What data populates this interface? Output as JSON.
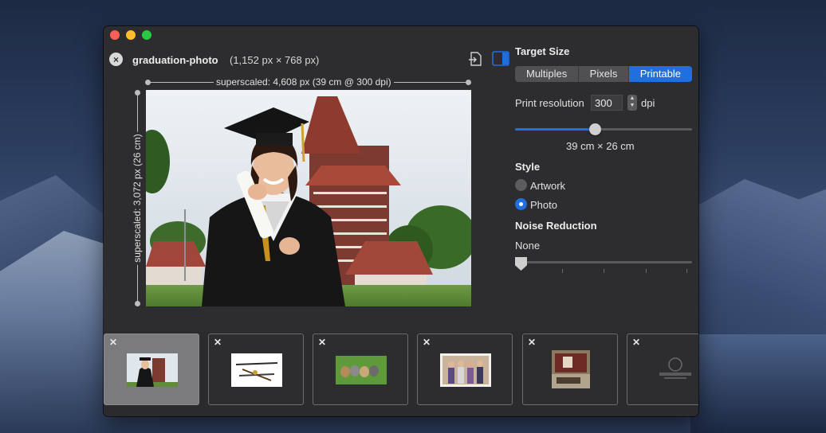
{
  "window": {
    "file_name": "graduation-photo",
    "file_size": "(1,152 px × 768 px)"
  },
  "preview": {
    "width_label": "superscaled: 4,608 px (39 cm @ 300 dpi)",
    "height_label": "superscaled: 3,072 px (26 cm)"
  },
  "sidebar": {
    "target_size_title": "Target Size",
    "modes": [
      "Multiples",
      "Pixels",
      "Printable"
    ],
    "active_mode": "Printable",
    "print_resolution_label": "Print resolution",
    "print_resolution_value": "300",
    "dpi_label": "dpi",
    "resolution_slider_fraction": 0.45,
    "print_size": "39 cm × 26 cm",
    "style_title": "Style",
    "style_options": [
      "Artwork",
      "Photo"
    ],
    "style_selected": "Photo",
    "noise_title": "Noise Reduction",
    "noise_value": "None",
    "noise_slider_fraction": 0.0
  },
  "thumbnails": [
    {
      "content": "graduation photo",
      "selected": true
    },
    {
      "content": "tools diagram",
      "selected": false
    },
    {
      "content": "kittens on grass",
      "selected": false
    },
    {
      "content": "group photo",
      "selected": false
    },
    {
      "content": "room interior",
      "selected": false
    },
    {
      "content": "logo",
      "selected": false
    }
  ],
  "icons": {
    "close": "×",
    "thumb_close": "✕"
  },
  "colors": {
    "accent": "#1f6fe0",
    "window_bg": "#2d2d2f"
  }
}
